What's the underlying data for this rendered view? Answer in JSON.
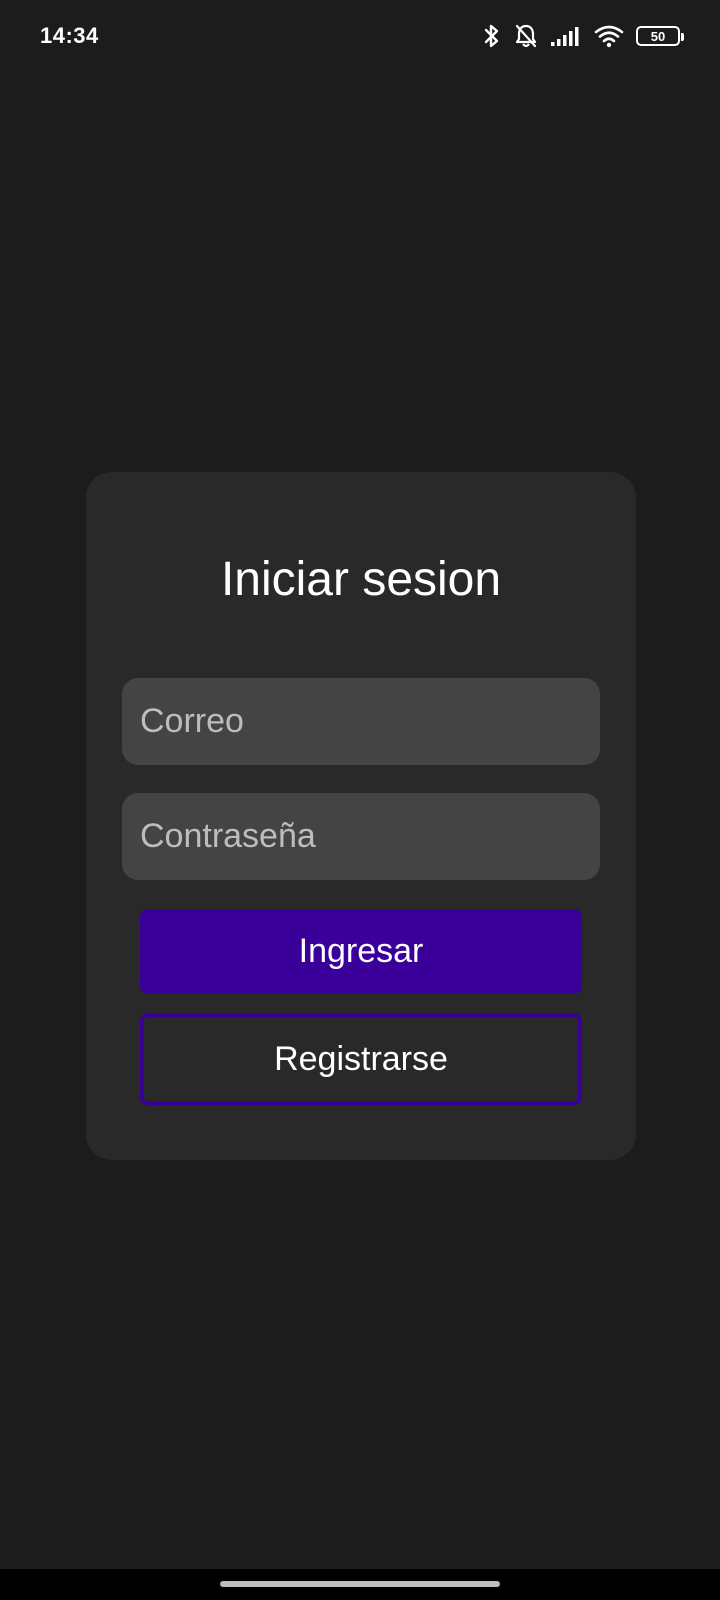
{
  "status_bar": {
    "time": "14:34",
    "battery_level": "50",
    "icons": [
      "bluetooth-icon",
      "bell-off-icon",
      "signal-icon",
      "wifi-icon",
      "battery-icon"
    ]
  },
  "login": {
    "title": "Iniciar sesion",
    "email_placeholder": "Correo",
    "password_placeholder": "Contraseña",
    "login_button": "Ingresar",
    "register_button": "Registrarse"
  },
  "colors": {
    "background": "#1c1c1c",
    "card": "#292929",
    "input": "#444444",
    "accent": "#3a0099"
  }
}
